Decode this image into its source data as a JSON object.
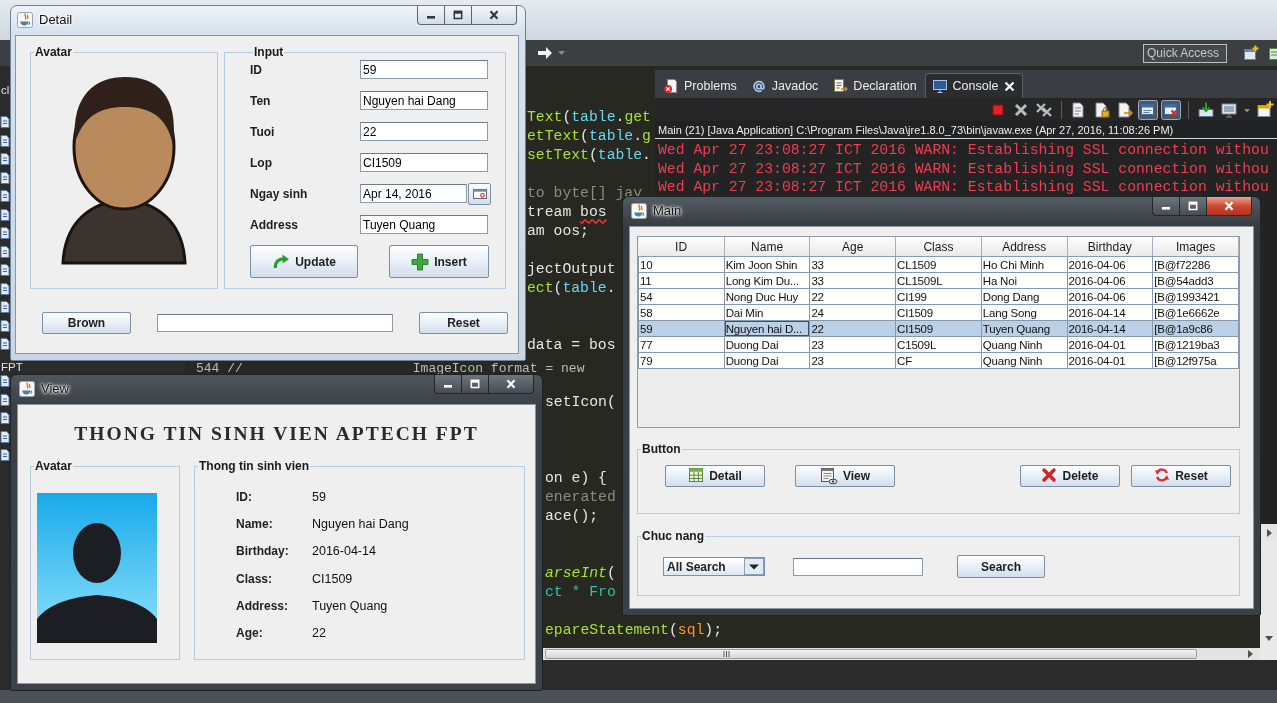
{
  "eclipse": {
    "toolbar": {
      "quick_access": {
        "placeholder": "Quick Access"
      }
    },
    "package_explorer": {
      "rows": [
        {
          "kind": "text",
          "text": "cl"
        },
        {
          "kind": "blank"
        },
        {
          "kind": "file"
        },
        {
          "kind": "file"
        },
        {
          "kind": "file"
        },
        {
          "kind": "file"
        },
        {
          "kind": "file"
        },
        {
          "kind": "file"
        },
        {
          "kind": "file"
        },
        {
          "kind": "file"
        },
        {
          "kind": "file"
        },
        {
          "kind": "file"
        },
        {
          "kind": "file"
        },
        {
          "kind": "file"
        },
        {
          "kind": "file"
        },
        {
          "kind": "text",
          "text": "FPT"
        },
        {
          "kind": "file"
        },
        {
          "kind": "file"
        },
        {
          "kind": "file"
        },
        {
          "kind": "file"
        },
        {
          "kind": "file"
        }
      ]
    },
    "editor": {
      "lines": [
        {
          "kind": "code",
          "tokens": [
            {
              "text": "Text",
              "kind": "method"
            },
            {
              "text": "(",
              "kind": "plain"
            },
            {
              "text": "table",
              "kind": "field"
            },
            {
              "text": ".",
              "kind": "plain"
            },
            {
              "text": "get",
              "kind": "method"
            }
          ]
        },
        {
          "kind": "code",
          "tokens": [
            {
              "text": "etText",
              "kind": "method"
            },
            {
              "text": "(",
              "kind": "plain"
            },
            {
              "text": "table",
              "kind": "field"
            },
            {
              "text": ".",
              "kind": "plain"
            },
            {
              "text": "g",
              "kind": "method"
            }
          ]
        },
        {
          "kind": "code",
          "tokens": [
            {
              "text": "setText",
              "kind": "method"
            },
            {
              "text": "(",
              "kind": "plain"
            },
            {
              "text": "table",
              "kind": "field"
            },
            {
              "text": ".",
              "kind": "plain"
            }
          ]
        },
        {
          "kind": "hidden"
        },
        {
          "kind": "code",
          "tokens": [
            {
              "text": "to byte[] jav",
              "kind": "comment"
            }
          ]
        },
        {
          "kind": "code",
          "tokens": [
            {
              "text": "tream ",
              "kind": "plain"
            },
            {
              "text": "bos",
              "kind": "warning"
            }
          ]
        },
        {
          "kind": "code",
          "tokens": [
            {
              "text": "am oos;",
              "kind": "plain"
            }
          ]
        },
        {
          "kind": "hidden"
        },
        {
          "kind": "code",
          "tokens": [
            {
              "text": "jectOutput",
              "kind": "plain"
            }
          ]
        },
        {
          "kind": "code",
          "tokens": [
            {
              "text": "ect",
              "kind": "method"
            },
            {
              "text": "(",
              "kind": "plain"
            },
            {
              "text": "table",
              "kind": "field"
            },
            {
              "text": ".",
              "kind": "plain"
            }
          ]
        },
        {
          "kind": "hidden"
        },
        {
          "kind": "hidden"
        },
        {
          "kind": "code",
          "tokens": [
            {
              "text": "data = bos",
              "kind": "plain"
            }
          ]
        },
        {
          "kind": "strip",
          "segments": [
            "544 //",
            "ImageIcon format = new"
          ]
        },
        {
          "kind": "hidden"
        },
        {
          "kind": "code",
          "tokens": [
            {
              "text": "setIcon(",
              "kind": "plain"
            }
          ]
        },
        {
          "kind": "hidden"
        },
        {
          "kind": "hidden"
        },
        {
          "kind": "hidden"
        },
        {
          "kind": "code",
          "tokens": [
            {
              "text": "on e) {",
              "kind": "plain"
            }
          ]
        },
        {
          "kind": "code",
          "tokens": [
            {
              "text": "enerated",
              "kind": "comment"
            }
          ]
        },
        {
          "kind": "code",
          "tokens": [
            {
              "text": "ace();",
              "kind": "plain"
            }
          ]
        },
        {
          "kind": "hidden"
        },
        {
          "kind": "hidden"
        },
        {
          "kind": "code",
          "tokens": [
            {
              "text": "arseInt",
              "kind": "static"
            },
            {
              "text": "(",
              "kind": "plain"
            }
          ]
        },
        {
          "kind": "code",
          "tokens": [
            {
              "text": "ct * Fro",
              "kind": "string"
            }
          ]
        },
        {
          "kind": "hidden"
        },
        {
          "kind": "code",
          "tokens": [
            {
              "text": "epareStatement",
              "kind": "method"
            },
            {
              "text": "(",
              "kind": "plain"
            },
            {
              "text": "sql",
              "kind": "param"
            },
            {
              "text": ");",
              "kind": "plain"
            }
          ]
        }
      ]
    },
    "console": {
      "tabs": [
        {
          "kind": "problems",
          "label": "Problems",
          "selected": false
        },
        {
          "kind": "javadoc",
          "label": "Javadoc",
          "selected": false
        },
        {
          "kind": "declaration",
          "label": "Declaration",
          "selected": false
        },
        {
          "kind": "console",
          "label": "Console",
          "selected": true
        }
      ],
      "tool_groups": [
        [
          {
            "kind": "stop",
            "pressed": false
          },
          {
            "kind": "cross",
            "pressed": false
          },
          {
            "kind": "double-cross",
            "pressed": false
          }
        ],
        [
          {
            "kind": "document",
            "pressed": false
          },
          {
            "kind": "padlock",
            "pressed": false
          },
          {
            "kind": "document-arrow",
            "pressed": false
          },
          {
            "kind": "window",
            "pressed": true
          },
          {
            "kind": "window-cross",
            "pressed": true
          }
        ],
        [
          {
            "kind": "tray",
            "pressed": false
          },
          {
            "kind": "monitor",
            "pressed": false
          },
          {
            "kind": "caret",
            "pressed": false
          },
          {
            "kind": "new-window",
            "pressed": false
          }
        ]
      ],
      "process": "Main (21) [Java Application] C:\\Program Files\\Java\\jre1.8.0_73\\bin\\javaw.exe (Apr 27, 2016, 11:08:26 PM)",
      "output": [
        "Wed Apr 27 23:08:27 ICT 2016 WARN: Establishing SSL connection withou",
        "Wed Apr 27 23:08:27 ICT 2016 WARN: Establishing SSL connection withou",
        "Wed Apr 27 23:08:27 ICT 2016 WARN: Establishing SSL connection withou"
      ]
    }
  },
  "detail_window": {
    "title": "Detail",
    "active": false,
    "avatar_group": {
      "title": "Avatar"
    },
    "input_group": {
      "title": "Input",
      "fields": [
        {
          "kind": "text",
          "label": "ID",
          "value": "59"
        },
        {
          "kind": "text",
          "label": "Ten",
          "value": "Nguyen hai Dang"
        },
        {
          "kind": "text",
          "label": "Tuoi",
          "value": "22"
        },
        {
          "kind": "text",
          "label": "Lop",
          "value": "CI1509"
        },
        {
          "kind": "date",
          "label": "Ngay sinh",
          "value": "Apr 14, 2016"
        },
        {
          "kind": "text",
          "label": "Address",
          "value": "Tuyen Quang"
        }
      ],
      "buttons": [
        {
          "kind": "update",
          "label": "Update"
        },
        {
          "kind": "insert",
          "label": "Insert"
        }
      ]
    },
    "browse_button": "Brown",
    "reset_button": "Reset"
  },
  "view_window": {
    "title": "View",
    "active": false,
    "heading": "THONG TIN SINH VIEN APTECH FPT",
    "avatar_group": {
      "title": "Avatar"
    },
    "info_group": {
      "title": "Thong tin sinh vien",
      "rows": [
        {
          "label": "ID:",
          "value": "59"
        },
        {
          "label": "Name:",
          "value": "Nguyen hai Dang"
        },
        {
          "label": "Birthday:",
          "value": "2016-04-14"
        },
        {
          "label": "Class:",
          "value": "CI1509"
        },
        {
          "label": "Address:",
          "value": "Tuyen Quang"
        },
        {
          "label": "Age:",
          "value": "22"
        }
      ]
    }
  },
  "main_window": {
    "title": "Main",
    "active": true,
    "table": {
      "columns": [
        "ID",
        "Name",
        "Age",
        "Class",
        "Address",
        "Birthday",
        "Images"
      ],
      "rows": [
        {
          "selected": false,
          "cells": [
            {
              "text": "10",
              "focused": false
            },
            {
              "text": "Kim Joon Shin",
              "focused": false
            },
            {
              "text": "33",
              "focused": false
            },
            {
              "text": "CL1509",
              "focused": false
            },
            {
              "text": "Ho Chi Minh",
              "focused": false
            },
            {
              "text": "2016-04-06",
              "focused": false
            },
            {
              "text": "[B@f72286",
              "focused": false
            }
          ]
        },
        {
          "selected": false,
          "cells": [
            {
              "text": "11",
              "focused": false
            },
            {
              "text": "Long Kim Du...",
              "focused": false
            },
            {
              "text": "33",
              "focused": false
            },
            {
              "text": "CL1509L",
              "focused": false
            },
            {
              "text": "Ha Noi",
              "focused": false
            },
            {
              "text": "2016-04-06",
              "focused": false
            },
            {
              "text": "[B@54add3",
              "focused": false
            }
          ]
        },
        {
          "selected": false,
          "cells": [
            {
              "text": "54",
              "focused": false
            },
            {
              "text": "Nong Duc Huy",
              "focused": false
            },
            {
              "text": "22",
              "focused": false
            },
            {
              "text": "CI199",
              "focused": false
            },
            {
              "text": "Dong Dang",
              "focused": false
            },
            {
              "text": "2016-04-06",
              "focused": false
            },
            {
              "text": "[B@1993421",
              "focused": false
            }
          ]
        },
        {
          "selected": false,
          "cells": [
            {
              "text": "58",
              "focused": false
            },
            {
              "text": "Dai Min",
              "focused": false
            },
            {
              "text": "24",
              "focused": false
            },
            {
              "text": "CI1509",
              "focused": false
            },
            {
              "text": "Lang Song",
              "focused": false
            },
            {
              "text": "2016-04-14",
              "focused": false
            },
            {
              "text": "[B@1e6662e",
              "focused": false
            }
          ]
        },
        {
          "selected": true,
          "cells": [
            {
              "text": "59",
              "focused": false
            },
            {
              "text": "Nguyen hai D...",
              "focused": true
            },
            {
              "text": "22",
              "focused": false
            },
            {
              "text": "CI1509",
              "focused": false
            },
            {
              "text": "Tuyen Quang",
              "focused": false
            },
            {
              "text": "2016-04-14",
              "focused": false
            },
            {
              "text": "[B@1a9c86",
              "focused": false
            }
          ]
        },
        {
          "selected": false,
          "cells": [
            {
              "text": "77",
              "focused": false
            },
            {
              "text": "Duong Dai",
              "focused": false
            },
            {
              "text": "23",
              "focused": false
            },
            {
              "text": "C1509L",
              "focused": false
            },
            {
              "text": "Quang Ninh",
              "focused": false
            },
            {
              "text": "2016-04-01",
              "focused": false
            },
            {
              "text": "[B@1219ba3",
              "focused": false
            }
          ]
        },
        {
          "selected": false,
          "cells": [
            {
              "text": "79",
              "focused": false
            },
            {
              "text": "Duong Dai",
              "focused": false
            },
            {
              "text": "23",
              "focused": false
            },
            {
              "text": "CF",
              "focused": false
            },
            {
              "text": "Quang Ninh",
              "focused": false
            },
            {
              "text": "2016-04-01",
              "focused": false
            },
            {
              "text": "[B@12f975a",
              "focused": false
            }
          ]
        }
      ]
    },
    "button_group": {
      "title": "Button",
      "buttons": [
        {
          "kind": "detail",
          "label": "Detail"
        },
        {
          "kind": "view",
          "label": "View"
        },
        {
          "kind": "delete",
          "label": "Delete"
        },
        {
          "kind": "reset",
          "label": "Reset"
        }
      ]
    },
    "function_group": {
      "title": "Chuc nang",
      "search_type": "All Search",
      "search_button": "Search"
    }
  }
}
